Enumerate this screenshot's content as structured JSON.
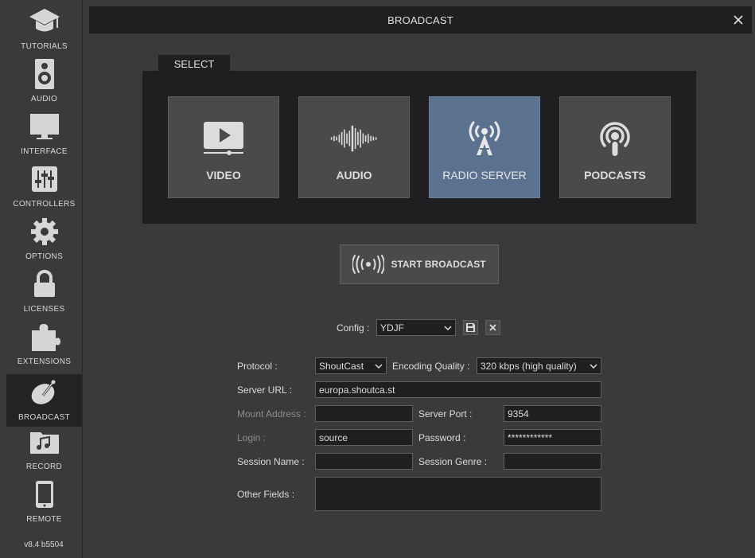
{
  "sidebar": {
    "items": [
      {
        "label": "TUTORIALS",
        "icon": "graduation-cap-icon"
      },
      {
        "label": "AUDIO",
        "icon": "speaker-icon"
      },
      {
        "label": "INTERFACE",
        "icon": "monitor-icon"
      },
      {
        "label": "CONTROLLERS",
        "icon": "sliders-icon"
      },
      {
        "label": "OPTIONS",
        "icon": "gear-icon"
      },
      {
        "label": "LICENSES",
        "icon": "lock-icon"
      },
      {
        "label": "EXTENSIONS",
        "icon": "puzzle-icon"
      },
      {
        "label": "BROADCAST",
        "icon": "broadcast-dish-icon",
        "active": true
      },
      {
        "label": "RECORD",
        "icon": "music-folder-icon"
      },
      {
        "label": "REMOTE",
        "icon": "phone-icon"
      }
    ],
    "version": "v8.4 b5504"
  },
  "title": "BROADCAST",
  "select": {
    "tab_label": "SELECT",
    "tiles": [
      {
        "label": "VIDEO",
        "icon": "video-play-icon"
      },
      {
        "label": "AUDIO",
        "icon": "waveform-icon"
      },
      {
        "label": "RADIO SERVER",
        "icon": "radio-tower-icon",
        "active": true
      },
      {
        "label": "PODCASTS",
        "icon": "podcast-icon"
      }
    ]
  },
  "start_broadcast": {
    "label": "START BROADCAST",
    "icon": "broadcast-waves-icon"
  },
  "config": {
    "label": "Config :",
    "value": "YDJF"
  },
  "form": {
    "protocol_label": "Protocol :",
    "protocol_value": "ShoutCast",
    "encoding_label": "Encoding Quality :",
    "encoding_value": "320 kbps (high quality)",
    "server_url_label": "Server URL :",
    "server_url_value": "europa.shoutca.st",
    "mount_label": "Mount Address :",
    "mount_value": "",
    "server_port_label": "Server Port :",
    "server_port_value": "9354",
    "login_label": "Login :",
    "login_value": "source",
    "password_label": "Password :",
    "password_value": "************",
    "session_name_label": "Session Name :",
    "session_name_value": "",
    "session_genre_label": "Session Genre :",
    "session_genre_value": "",
    "other_fields_label": "Other Fields :",
    "other_fields_value": ""
  },
  "colors": {
    "background": "#3a3a3c",
    "dark_panel": "#1f1f21",
    "tile": "#4a4a4c",
    "active_tile": "#5a718f"
  }
}
